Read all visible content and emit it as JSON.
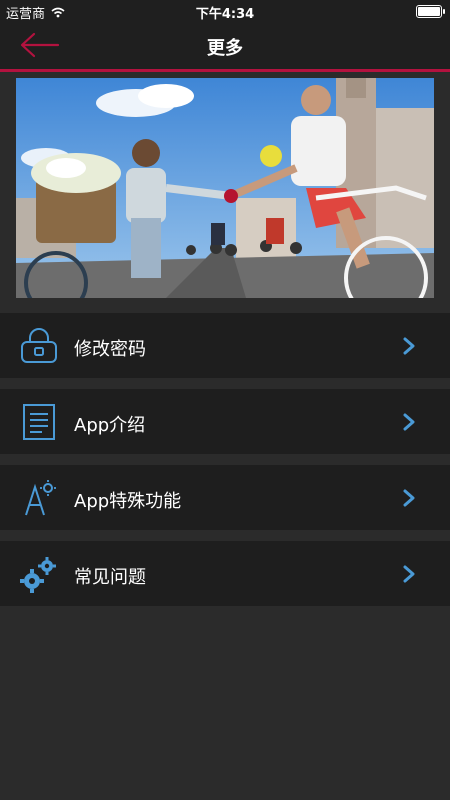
{
  "status_bar": {
    "carrier": "运营商",
    "time": "下午4:34"
  },
  "nav": {
    "title": "更多"
  },
  "banner": {
    "description_icon": "cyclists-photo"
  },
  "menu": [
    {
      "label": "修改密码",
      "icon": "lock-icon"
    },
    {
      "label": "App介绍",
      "icon": "document-icon"
    },
    {
      "label": "App特殊功能",
      "icon": "special-feature-icon"
    },
    {
      "label": "常见问题",
      "icon": "gears-icon"
    }
  ],
  "colors": {
    "accent": "#b3123f",
    "icon": "#4a9ad6",
    "background": "#2b2b2b",
    "row": "#1e1e1e"
  }
}
